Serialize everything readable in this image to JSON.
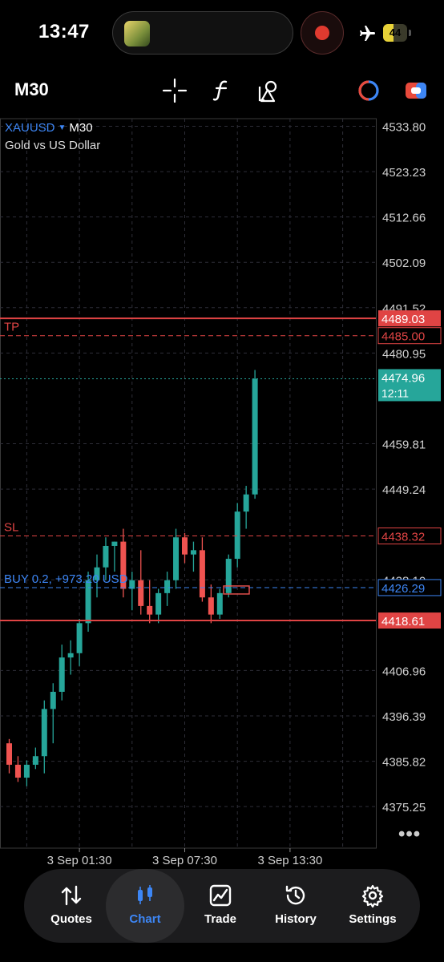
{
  "status_bar": {
    "time": "13:47",
    "battery_level": "44",
    "battery_fraction": 0.44
  },
  "toolbar": {
    "timeframe": "M30",
    "tools": [
      "crosshair-icon",
      "function-icon",
      "objects-icon",
      "one-click-trading-icon",
      "trade-toggle-icon"
    ]
  },
  "chart_data": {
    "type": "candlestick",
    "symbol": "XAUUSD",
    "timeframe": "M30",
    "description": "Gold vs US Dollar",
    "ylim": [
      4368.0,
      4536.0
    ],
    "y_ticks": [
      4533.8,
      4523.23,
      4512.66,
      4502.09,
      4491.52,
      4480.95,
      4459.81,
      4449.24,
      4428.1,
      4406.96,
      4396.39,
      4385.82,
      4375.25
    ],
    "y_tick_labels": [
      "4533.80",
      "4523.23",
      "4512.66",
      "4502.09",
      "4491.52",
      "4480.95",
      "4459.81",
      "4449.24",
      "4428.10",
      "4406.96",
      "4396.39",
      "4385.82",
      "4375.25"
    ],
    "x_tick_labels": [
      {
        "label": "3 Sep 01:30",
        "bar": 8
      },
      {
        "label": "3 Sep 07:30",
        "bar": 20
      },
      {
        "label": "3 Sep 13:30",
        "bar": 32
      }
    ],
    "grid": true,
    "candles": [
      {
        "o": 4390,
        "h": 4391,
        "l": 4383,
        "c": 4385
      },
      {
        "o": 4385,
        "h": 4387,
        "l": 4381,
        "c": 4382
      },
      {
        "o": 4382,
        "h": 4386,
        "l": 4380,
        "c": 4385
      },
      {
        "o": 4385,
        "h": 4389,
        "l": 4384,
        "c": 4387
      },
      {
        "o": 4387,
        "h": 4400,
        "l": 4383,
        "c": 4398
      },
      {
        "o": 4398,
        "h": 4404,
        "l": 4390,
        "c": 4402
      },
      {
        "o": 4402,
        "h": 4413,
        "l": 4400,
        "c": 4410
      },
      {
        "o": 4410,
        "h": 4414,
        "l": 4406,
        "c": 4411
      },
      {
        "o": 4411,
        "h": 4419,
        "l": 4408,
        "c": 4418
      },
      {
        "o": 4418,
        "h": 4430,
        "l": 4416,
        "c": 4428
      },
      {
        "o": 4428,
        "h": 4434,
        "l": 4424,
        "c": 4431
      },
      {
        "o": 4431,
        "h": 4438,
        "l": 4428,
        "c": 4436
      },
      {
        "o": 4436,
        "h": 4437,
        "l": 4430,
        "c": 4437
      },
      {
        "o": 4437,
        "h": 4440,
        "l": 4424,
        "c": 4426
      },
      {
        "o": 4426,
        "h": 4430,
        "l": 4421,
        "c": 4428
      },
      {
        "o": 4428,
        "h": 4435,
        "l": 4420,
        "c": 4422
      },
      {
        "o": 4422,
        "h": 4428,
        "l": 4418,
        "c": 4420
      },
      {
        "o": 4420,
        "h": 4426,
        "l": 4418,
        "c": 4425
      },
      {
        "o": 4425,
        "h": 4430,
        "l": 4422,
        "c": 4428
      },
      {
        "o": 4428,
        "h": 4440,
        "l": 4426,
        "c": 4438
      },
      {
        "o": 4438,
        "h": 4439,
        "l": 4432,
        "c": 4434
      },
      {
        "o": 4434,
        "h": 4437,
        "l": 4430,
        "c": 4435
      },
      {
        "o": 4435,
        "h": 4438,
        "l": 4423,
        "c": 4424
      },
      {
        "o": 4424,
        "h": 4427,
        "l": 4418,
        "c": 4420
      },
      {
        "o": 4420,
        "h": 4426,
        "l": 4419,
        "c": 4425
      },
      {
        "o": 4425,
        "h": 4434,
        "l": 4424,
        "c": 4433
      },
      {
        "o": 4433,
        "h": 4446,
        "l": 4431,
        "c": 4444
      },
      {
        "o": 4444,
        "h": 4450,
        "l": 4440,
        "c": 4448
      },
      {
        "o": 4448,
        "h": 4477,
        "l": 4447,
        "c": 4474.96
      }
    ],
    "bull_color": "#26a69a",
    "bear_color": "#ef5350",
    "levels": [
      {
        "name": "TP",
        "price": 4485.0,
        "label": "TP",
        "price_label": "4485.00",
        "color": "#e04444",
        "style": "dashed"
      },
      {
        "name": "SL",
        "price": 4438.32,
        "label": "SL",
        "price_label": "4438.32",
        "color": "#e04444",
        "style": "dashed"
      },
      {
        "name": "BUY 0.2, +973.20 USD",
        "price": 4426.29,
        "label": "BUY 0.2, +973.20 USD",
        "price_label": "4426.29",
        "color": "#3d86f5",
        "style": "dashed"
      },
      {
        "name": "bid",
        "price": 4474.96,
        "price_label": "4474.96",
        "countdown": "12:11",
        "color": "#26a69a",
        "style": "dotted"
      },
      {
        "name": "upper",
        "price": 4489.03,
        "price_label": "4489.03",
        "color": "#e04444",
        "style": "solid"
      },
      {
        "name": "lower",
        "price": 4418.61,
        "price_label": "4418.61",
        "color": "#e04444",
        "style": "solid"
      }
    ]
  },
  "more_label": "•••",
  "nav": {
    "items": [
      {
        "label": "Quotes",
        "icon": "quotes-icon",
        "active": false
      },
      {
        "label": "Chart",
        "icon": "chart-icon",
        "active": true
      },
      {
        "label": "Trade",
        "icon": "trade-icon",
        "active": false
      },
      {
        "label": "History",
        "icon": "history-icon",
        "active": false
      },
      {
        "label": "Settings",
        "icon": "settings-icon",
        "active": false
      }
    ]
  }
}
